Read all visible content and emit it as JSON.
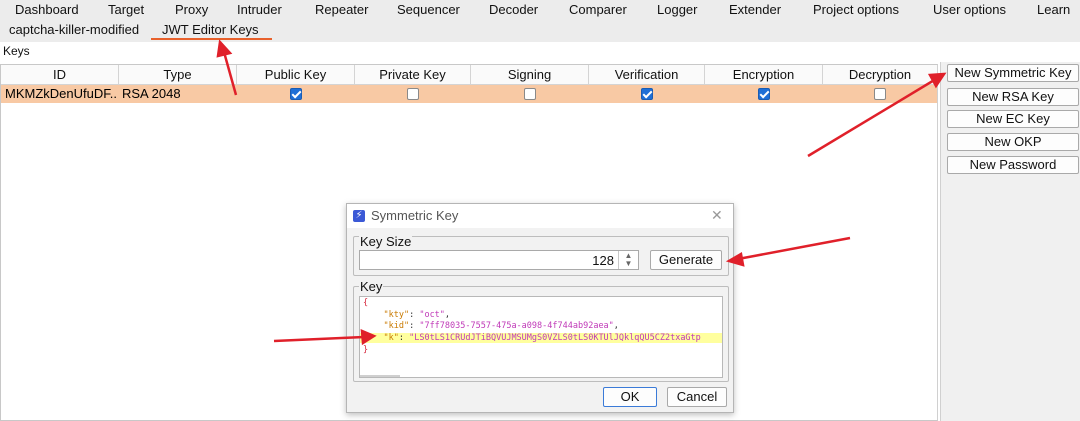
{
  "top_tabs": [
    "Dashboard",
    "Target",
    "Proxy",
    "Intruder",
    "Repeater",
    "Sequencer",
    "Decoder",
    "Comparer",
    "Logger",
    "Extender",
    "Project options",
    "User options",
    "Learn"
  ],
  "sub_tabs": [
    {
      "label": "captcha-killer-modified",
      "active": false
    },
    {
      "label": "JWT Editor Keys",
      "active": true
    }
  ],
  "keys_label": "Keys",
  "table": {
    "columns": [
      "ID",
      "Type",
      "Public Key",
      "Private Key",
      "Signing",
      "Verification",
      "Encryption",
      "Decryption"
    ],
    "rows": [
      {
        "id": "MKMZkDenUfuDF...",
        "type": "RSA 2048",
        "public_key": true,
        "private_key": false,
        "signing": false,
        "verification": true,
        "encryption": true,
        "decryption": false
      }
    ],
    "selected_row_color": "#f8c9a4"
  },
  "side_buttons": [
    "New Symmetric Key",
    "New RSA Key",
    "New EC Key",
    "New OKP",
    "New Password"
  ],
  "dialog": {
    "title": "Symmetric Key",
    "key_size_legend": "Key Size",
    "key_size_value": "128",
    "generate_label": "Generate",
    "key_legend": "Key",
    "key_lines": {
      "open": "{",
      "kty_key": "\"kty\"",
      "kty_val": "\"oct\"",
      "kid_key": "\"kid\"",
      "kid_val": "\"7ff78035-7557-475a-a098-4f744ab92aea\"",
      "k_key": "\"k\"",
      "k_val": "\"LS0tLS1CRUdJTiBQVUJMSUMgS0VZLS0tLS0KTUlJQklqQU5CZ2txaGtp",
      "close": "}"
    },
    "ok_label": "OK",
    "cancel_label": "Cancel"
  },
  "colors": {
    "accent_tab": "#e8612c",
    "annotation_arrow": "#e0202a",
    "checkbox_checked": "#1f6fd6"
  }
}
